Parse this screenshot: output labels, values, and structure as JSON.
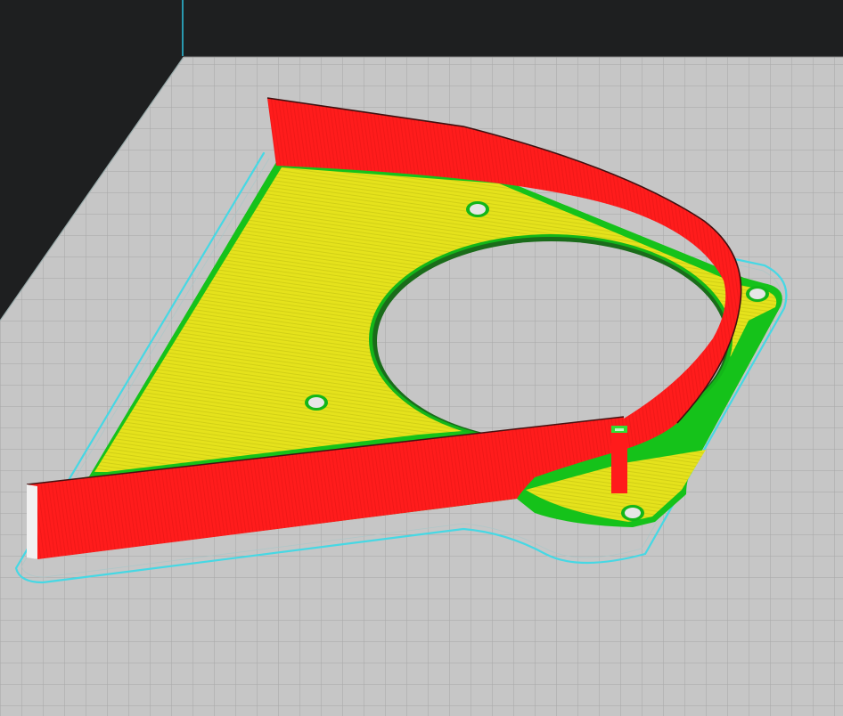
{
  "viewer": {
    "background_color": "#1e1f20",
    "build_plate_color": "#c4c4c4",
    "grid_line_color": "#ababab",
    "build_volume_edge_color": "#32c0d8"
  },
  "model": {
    "layer_view": "line-type",
    "colors": {
      "outer_wall": "#ff1a1a",
      "infill": "#e9e81a",
      "inner_wall": "#18e018",
      "skirt": "#3bd6e0"
    },
    "features": [
      "fan-duct-bracket",
      "round-cutout",
      "mounting-holes",
      "curved-wall",
      "straight-wall",
      "support-post"
    ]
  }
}
